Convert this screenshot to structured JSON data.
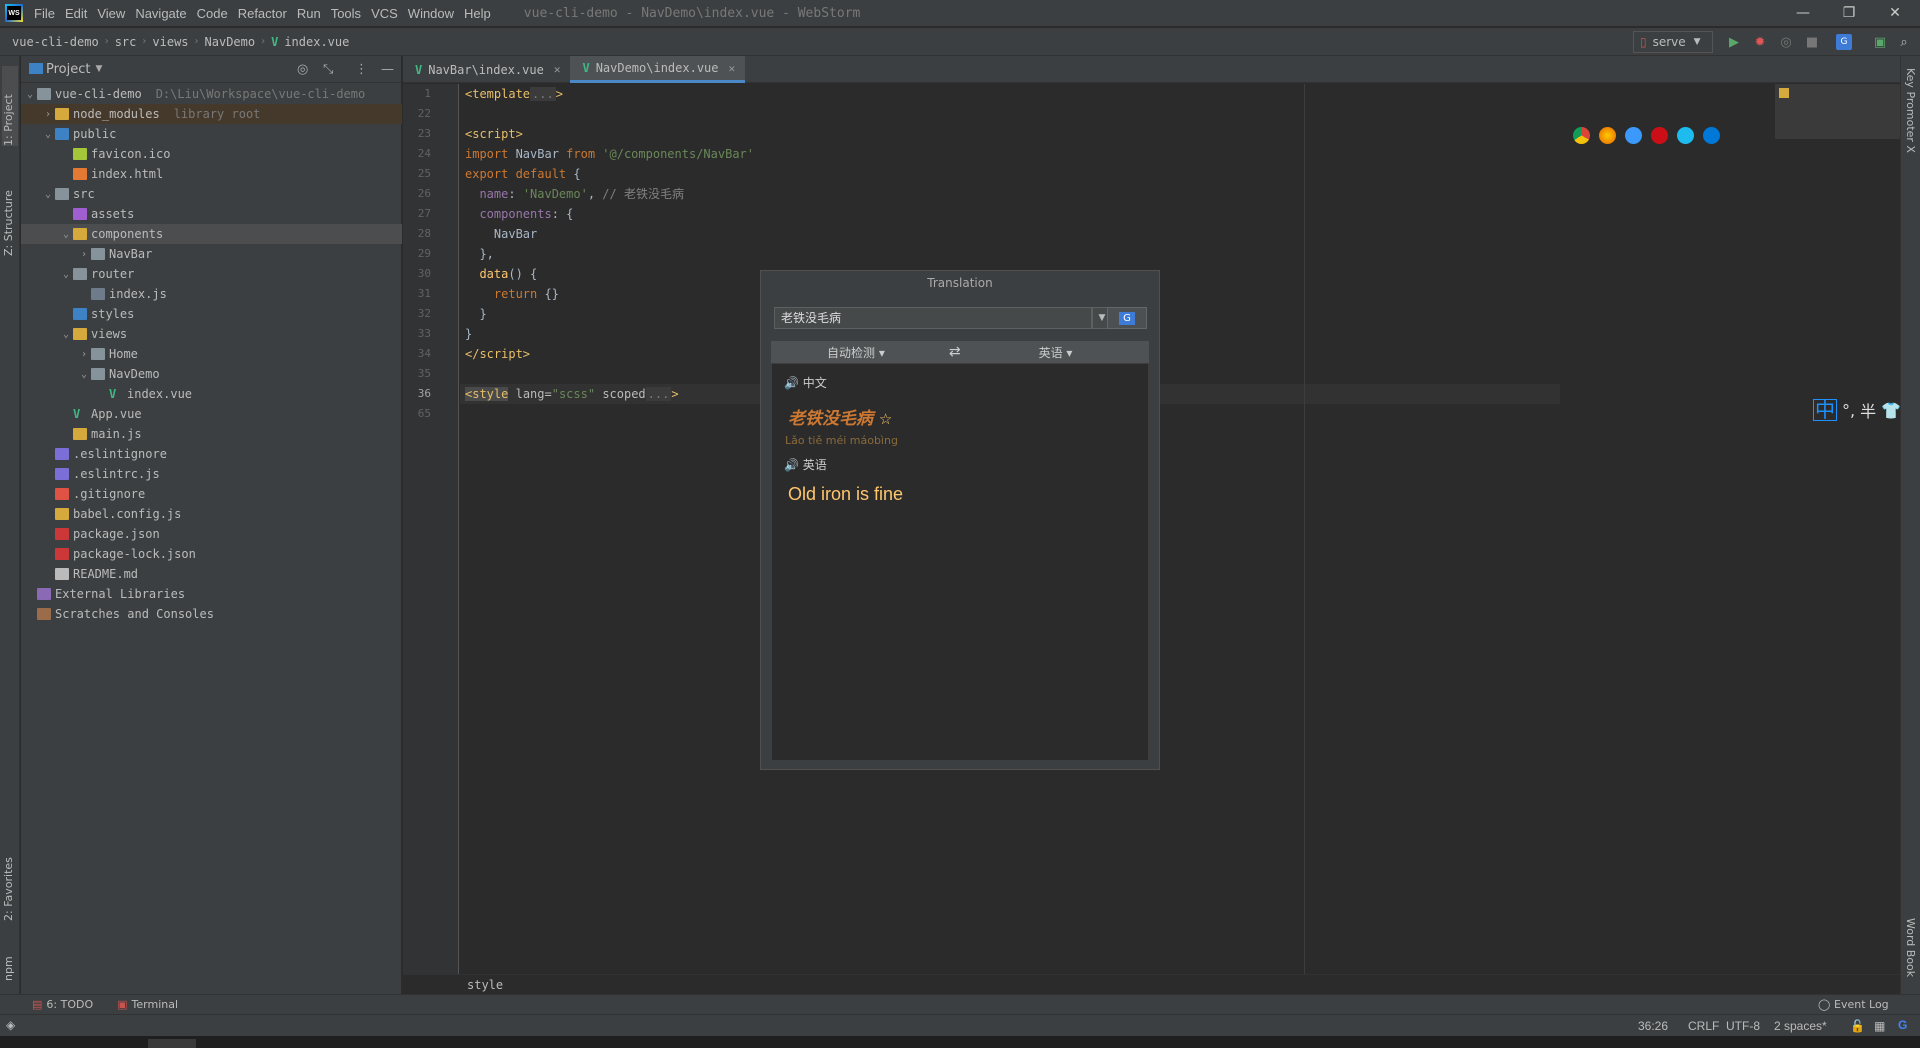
{
  "window": {
    "title": "vue-cli-demo - NavDemo\\index.vue - WebStorm",
    "logo": "WS",
    "menu": [
      "File",
      "Edit",
      "View",
      "Navigate",
      "Code",
      "Refactor",
      "Run",
      "Tools",
      "VCS",
      "Window",
      "Help"
    ]
  },
  "breadcrumb": [
    "vue-cli-demo",
    "src",
    "views",
    "NavDemo",
    "index.vue"
  ],
  "toolbar": {
    "run_config": "serve"
  },
  "left_stripe": {
    "project": "1: Project",
    "structure": "Z: Structure",
    "favorites": "2: Favorites",
    "npm": "npm"
  },
  "right_stripe": {
    "key_promoter": "Key Promoter X",
    "word_book": "Word Book"
  },
  "project_panel": {
    "title": "Project",
    "tree": [
      {
        "label": "vue-cli-demo",
        "hint": "D:\\Liu\\Workspace\\vue-cli-demo",
        "depth": 0,
        "arrow": "down",
        "icon": "folder"
      },
      {
        "label": "node_modules",
        "hint": "library root",
        "depth": 1,
        "arrow": "right",
        "icon": "folder-yellow"
      },
      {
        "label": "public",
        "hint": "",
        "depth": 1,
        "arrow": "down",
        "icon": "folder-blue"
      },
      {
        "label": "favicon.ico",
        "hint": "",
        "depth": 2,
        "arrow": "",
        "icon": "ico"
      },
      {
        "label": "index.html",
        "hint": "",
        "depth": 2,
        "arrow": "",
        "icon": "html"
      },
      {
        "label": "src",
        "hint": "",
        "depth": 1,
        "arrow": "down",
        "icon": "folder"
      },
      {
        "label": "assets",
        "hint": "",
        "depth": 2,
        "arrow": "",
        "icon": "folder-purple"
      },
      {
        "label": "components",
        "hint": "",
        "depth": 2,
        "arrow": "down",
        "icon": "folder-yellow"
      },
      {
        "label": "NavBar",
        "hint": "",
        "depth": 3,
        "arrow": "right",
        "icon": "folder"
      },
      {
        "label": "router",
        "hint": "",
        "depth": 2,
        "arrow": "down",
        "icon": "folder"
      },
      {
        "label": "index.js",
        "hint": "",
        "depth": 3,
        "arrow": "",
        "icon": "js-list"
      },
      {
        "label": "styles",
        "hint": "",
        "depth": 2,
        "arrow": "",
        "icon": "folder-blue"
      },
      {
        "label": "views",
        "hint": "",
        "depth": 2,
        "arrow": "down",
        "icon": "folder-yellow"
      },
      {
        "label": "Home",
        "hint": "",
        "depth": 3,
        "arrow": "right",
        "icon": "folder"
      },
      {
        "label": "NavDemo",
        "hint": "",
        "depth": 3,
        "arrow": "down",
        "icon": "folder"
      },
      {
        "label": "index.vue",
        "hint": "",
        "depth": 4,
        "arrow": "",
        "icon": "vue"
      },
      {
        "label": "App.vue",
        "hint": "",
        "depth": 2,
        "arrow": "",
        "icon": "vue"
      },
      {
        "label": "main.js",
        "hint": "",
        "depth": 2,
        "arrow": "",
        "icon": "js"
      },
      {
        "label": ".eslintignore",
        "hint": "",
        "depth": 1,
        "arrow": "",
        "icon": "eslint"
      },
      {
        "label": ".eslintrc.js",
        "hint": "",
        "depth": 1,
        "arrow": "",
        "icon": "eslint"
      },
      {
        "label": ".gitignore",
        "hint": "",
        "depth": 1,
        "arrow": "",
        "icon": "git"
      },
      {
        "label": "babel.config.js",
        "hint": "",
        "depth": 1,
        "arrow": "",
        "icon": "babel"
      },
      {
        "label": "package.json",
        "hint": "",
        "depth": 1,
        "arrow": "",
        "icon": "npm"
      },
      {
        "label": "package-lock.json",
        "hint": "",
        "depth": 1,
        "arrow": "",
        "icon": "lock"
      },
      {
        "label": "README.md",
        "hint": "",
        "depth": 1,
        "arrow": "",
        "icon": "md"
      },
      {
        "label": "External Libraries",
        "hint": "",
        "depth": 0,
        "arrow": "",
        "icon": "lib"
      },
      {
        "label": "Scratches and Consoles",
        "hint": "",
        "depth": 0,
        "arrow": "",
        "icon": "scratch"
      }
    ]
  },
  "editor_tabs": [
    {
      "label": "NavBar\\index.vue",
      "active": false
    },
    {
      "label": "NavDemo\\index.vue",
      "active": true
    }
  ],
  "editor": {
    "line_numbers": [
      "1",
      "22",
      "23",
      "24",
      "25",
      "26",
      "27",
      "28",
      "29",
      "30",
      "31",
      "32",
      "33",
      "34",
      "35",
      "36",
      "65"
    ],
    "bottom_breadcrumb": "style"
  },
  "translation": {
    "title": "Translation",
    "input": "老铁没毛病",
    "source_lang": "自动检测",
    "swap": "⇄",
    "target_lang": "英语",
    "source_section": "中文",
    "source_word": "老铁没毛病",
    "pinyin": "Lǎo tiě méi máobìng",
    "target_section": "英语",
    "result": "Old iron is fine"
  },
  "ime": {
    "mode": "中",
    "punct": "°,",
    "width": "半"
  },
  "bottom_tools": {
    "todo": "6: TODO",
    "terminal": "Terminal",
    "event_log": "Event Log"
  },
  "status": {
    "position": "36:26",
    "line_sep": "CRLF",
    "encoding": "UTF-8",
    "indent": "2 spaces*"
  }
}
